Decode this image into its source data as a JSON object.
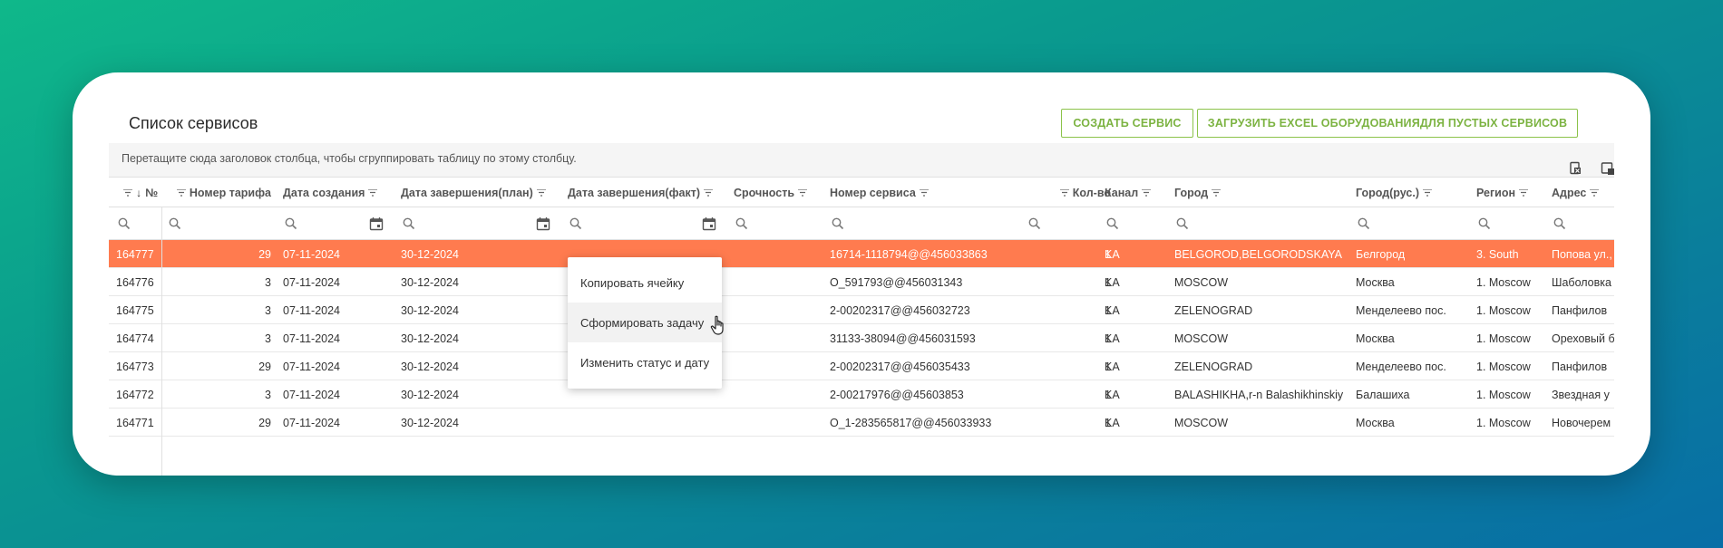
{
  "page": {
    "title": "Список сервисов",
    "create_button": "СОЗДАТЬ СЕРВИС",
    "upload_button": "ЗАГРУЗИТЬ EXCEL ОБОРУДОВАНИЯДЛЯ ПУСТЫХ СЕРВИСОВ"
  },
  "grid": {
    "group_hint": "Перетащите сюда заголовок столбца, чтобы сгруппировать таблицу по этому столбцу.",
    "toolbar_icons": [
      "export-excel-icon",
      "column-chooser-icon"
    ],
    "columns": {
      "id": "№",
      "tariff": "Номер тарифа",
      "created": "Дата создания",
      "end_plan": "Дата завершения(план)",
      "end_fact": "Дата завершения(факт)",
      "urgency": "Срочность",
      "service_no": "Номер сервиса",
      "qty": "Кол-во",
      "channel": "Канал",
      "city": "Город",
      "city_ru": "Город(рус.)",
      "region": "Регион",
      "address": "Адрес"
    },
    "rows": [
      {
        "id": "164777",
        "tariff": "29",
        "created": "07-11-2024",
        "end_plan": "30-12-2024",
        "end_fact": "",
        "urgency": "",
        "service_no": "16714-1118794@@456033863",
        "qty": "1",
        "channel": "KA",
        "city": "BELGOROD,BELGORODSKAYA",
        "city_ru": "Белгород",
        "region": "3. South",
        "address": "Попова ул.,"
      },
      {
        "id": "164776",
        "tariff": "3",
        "created": "07-11-2024",
        "end_plan": "30-12-2024",
        "end_fact": "",
        "urgency": "",
        "service_no": "O_591793@@456031343",
        "qty": "1",
        "channel": "KA",
        "city": "MOSCOW",
        "city_ru": "Москва",
        "region": "1. Moscow",
        "address": "Шаболовка"
      },
      {
        "id": "164775",
        "tariff": "3",
        "created": "07-11-2024",
        "end_plan": "30-12-2024",
        "end_fact": "",
        "urgency": "",
        "service_no": "2-00202317@@456032723",
        "qty": "1",
        "channel": "KA",
        "city": "ZELENOGRAD",
        "city_ru": "Менделеево пос.",
        "region": "1. Moscow",
        "address": "Панфилов"
      },
      {
        "id": "164774",
        "tariff": "3",
        "created": "07-11-2024",
        "end_plan": "30-12-2024",
        "end_fact": "",
        "urgency": "",
        "service_no": "31133-38094@@456031593",
        "qty": "1",
        "channel": "KA",
        "city": "MOSCOW",
        "city_ru": "Москва",
        "region": "1. Moscow",
        "address": "Ореховый б"
      },
      {
        "id": "164773",
        "tariff": "29",
        "created": "07-11-2024",
        "end_plan": "30-12-2024",
        "end_fact": "",
        "urgency": "",
        "service_no": "2-00202317@@456035433",
        "qty": "1",
        "channel": "KA",
        "city": "ZELENOGRAD",
        "city_ru": "Менделеево пос.",
        "region": "1. Moscow",
        "address": "Панфилов"
      },
      {
        "id": "164772",
        "tariff": "3",
        "created": "07-11-2024",
        "end_plan": "30-12-2024",
        "end_fact": "",
        "urgency": "",
        "service_no": "2-00217976@@45603853",
        "qty": "1",
        "channel": "KA",
        "city": "BALASHIKHA,r-n Balashikhinskiy",
        "city_ru": "Балашиха",
        "region": "1. Moscow",
        "address": "Звездная у"
      },
      {
        "id": "164771",
        "tariff": "29",
        "created": "07-11-2024",
        "end_plan": "30-12-2024",
        "end_fact": "",
        "urgency": "",
        "service_no": "O_1-283565817@@456033933",
        "qty": "1",
        "channel": "KA",
        "city": "MOSCOW",
        "city_ru": "Москва",
        "region": "1. Moscow",
        "address": "Новочерем"
      }
    ],
    "selected_row_color": "#ff7b4f"
  },
  "context_menu": {
    "items": [
      "Копировать ячейку",
      "Сформировать задачу",
      "Изменить статус и дату"
    ]
  },
  "colors": {
    "accent_green": "#7cb342",
    "selected_row": "#ff7b4f"
  }
}
